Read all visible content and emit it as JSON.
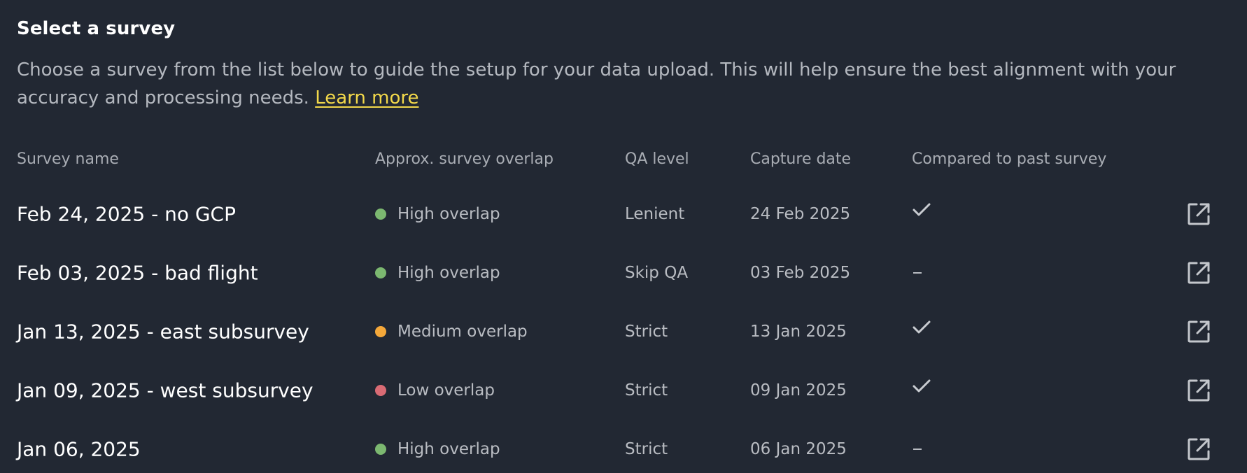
{
  "header": {
    "title": "Select a survey",
    "description": "Choose a survey from the list below to guide the setup for your data upload. This will help ensure the best alignment with your accuracy and processing needs. ",
    "learn_more": "Learn more"
  },
  "table": {
    "columns": {
      "name": "Survey name",
      "overlap": "Approx. survey overlap",
      "qa": "QA level",
      "date": "Capture date",
      "compared": "Compared to past survey"
    },
    "rows": [
      {
        "name": "Feb 24, 2025 - no GCP",
        "overlap": "High overlap",
        "overlap_color": "#7cb870",
        "qa": "Lenient",
        "date": "24 Feb 2025",
        "compared": true,
        "compared_icon": "check-icon"
      },
      {
        "name": "Feb 03, 2025 - bad flight",
        "overlap": "High overlap",
        "overlap_color": "#7cb870",
        "qa": "Skip QA",
        "date": "03 Feb 2025",
        "compared": false,
        "compared_icon": "dash-icon"
      },
      {
        "name": "Jan 13, 2025 - east subsurvey",
        "overlap": "Medium overlap",
        "overlap_color": "#f5a83a",
        "qa": "Strict",
        "date": "13 Jan 2025",
        "compared": true,
        "compared_icon": "check-icon"
      },
      {
        "name": "Jan 09, 2025 - west subsurvey",
        "overlap": "Low overlap",
        "overlap_color": "#d96b74",
        "qa": "Strict",
        "date": "09 Jan 2025",
        "compared": true,
        "compared_icon": "check-icon"
      },
      {
        "name": "Jan 06, 2025",
        "overlap": "High overlap",
        "overlap_color": "#7cb870",
        "qa": "Strict",
        "date": "06 Jan 2025",
        "compared": false,
        "compared_icon": "dash-icon"
      }
    ],
    "row_action_icon": "open-in-new-icon"
  },
  "colors": {
    "background": "#222833",
    "link": "#f2d84a",
    "high": "#7cb870",
    "medium": "#f5a83a",
    "low": "#d96b74"
  }
}
